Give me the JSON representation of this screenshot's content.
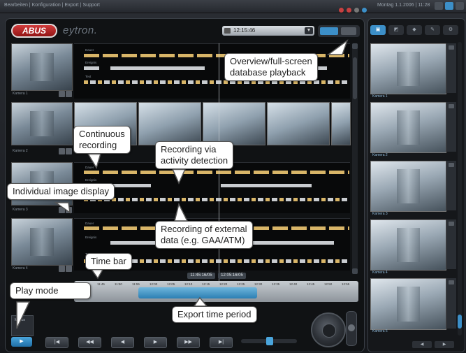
{
  "app": {
    "menu_text": "Bearbeiten | Konfiguration | Export | Support",
    "datetime": "Montag 1.1.2006 | 11:28",
    "logo_text": "ABUS",
    "brand_text": "eytron.",
    "camera_select": "12:15:46"
  },
  "rows": [
    {
      "label": "Kamera 1",
      "track_labels": [
        "Dauer",
        "Ereignis",
        "Text"
      ]
    },
    {
      "label": "Kamera 2",
      "track_labels": []
    },
    {
      "label": "Kamera 3",
      "track_labels": [
        "Dauer",
        "Ereignis",
        "Text"
      ]
    },
    {
      "label": "Kamera 4",
      "track_labels": [
        "Dauer",
        "Ereignis",
        "Text"
      ]
    }
  ],
  "timebar": {
    "badges": [
      "11:45:16/05",
      "12:05:16/05"
    ],
    "ticks": [
      "11:40",
      "11:45",
      "11:50",
      "11:55",
      "12:00",
      "12:05",
      "12:10",
      "12:15",
      "12:20",
      "12:25",
      "12:30",
      "12:35",
      "12:40",
      "12:45",
      "12:50",
      "12:55"
    ]
  },
  "transport": {
    "buttons": [
      "|◀",
      "◀◀",
      "◀",
      "▶",
      "▶▶",
      "▶|"
    ],
    "play_label": "▶",
    "playmode_text": "Modus"
  },
  "right_panel": {
    "tabs": [
      "▣",
      "◩",
      "◆",
      "✎",
      "⚙"
    ],
    "cams": [
      "Kamera 1",
      "Kamera 2",
      "Kamera 3",
      "Kamera 4",
      "Kamera 5"
    ],
    "bottom": [
      "◀",
      "▶"
    ]
  },
  "callouts": {
    "overview": "Overview/full-screen\ndatabase playback",
    "continuous": "Continuous\nrecording",
    "activity": "Recording via\nactivity detection",
    "individual": "Individual image display",
    "external": "Recording of external\ndata (e.g. GAA/ATM)",
    "timebar": "Time bar",
    "playmode": "Play mode",
    "export": "Export time period"
  },
  "colors": {
    "accent": "#3c8fc8",
    "event_bar": "#d8b568",
    "data_bar": "#c9ccd0"
  }
}
